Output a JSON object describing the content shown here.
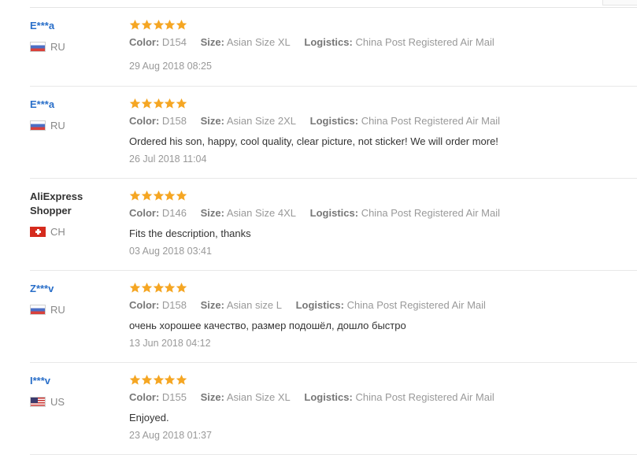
{
  "labels": {
    "color": "Color:",
    "size": "Size:",
    "logistics": "Logistics:"
  },
  "star_color": "#f5a623",
  "reviews": [
    {
      "user": "E***a",
      "country": "RU",
      "flag_icon": "russia-flag-icon",
      "rating": 5,
      "color": "D154",
      "size": "Asian Size XL",
      "logistics": "China Post Registered Air Mail",
      "text": "",
      "date": "29 Aug 2018 08:25"
    },
    {
      "user": "E***a",
      "country": "RU",
      "flag_icon": "russia-flag-icon",
      "rating": 5,
      "color": "D158",
      "size": "Asian Size 2XL",
      "logistics": "China Post Registered Air Mail",
      "text": "Ordered his son, happy, cool quality, clear picture, not sticker! We will order more!",
      "date": "26 Jul 2018 11:04"
    },
    {
      "user": "AliExpress Shopper",
      "country": "CH",
      "flag_icon": "switzerland-flag-icon",
      "rating": 5,
      "color": "D146",
      "size": "Asian Size 4XL",
      "logistics": "China Post Registered Air Mail",
      "text": "Fits the description, thanks",
      "date": "03 Aug 2018 03:41"
    },
    {
      "user": "Z***v",
      "country": "RU",
      "flag_icon": "russia-flag-icon",
      "rating": 5,
      "color": "D158",
      "size": "Asian size L",
      "logistics": "China Post Registered Air Mail",
      "text": "очень хорошее качество, размер подошёл, дошло быстро",
      "date": "13 Jun 2018 04:12"
    },
    {
      "user": "I***v",
      "country": "US",
      "flag_icon": "usa-flag-icon",
      "rating": 5,
      "color": "D155",
      "size": "Asian Size XL",
      "logistics": "China Post Registered Air Mail",
      "text": "Enjoyed.",
      "date": "23 Aug 2018 01:37"
    }
  ]
}
